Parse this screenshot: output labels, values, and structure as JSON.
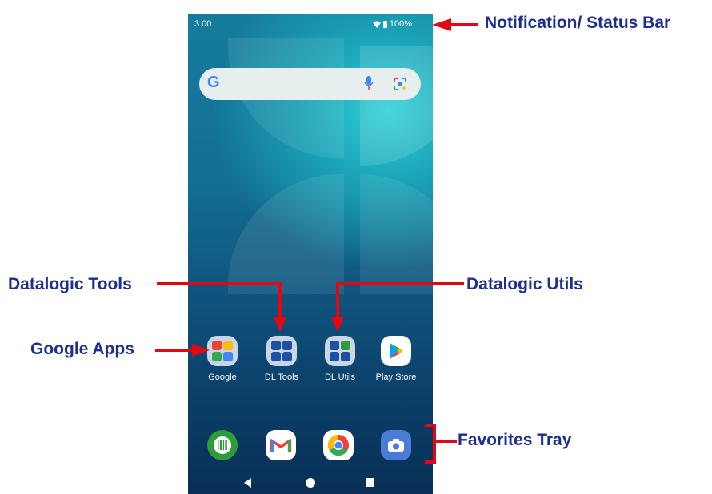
{
  "status_bar": {
    "time": "3:00",
    "battery": "100%"
  },
  "apps": [
    {
      "label": "Google"
    },
    {
      "label": "DL Tools"
    },
    {
      "label": "DL Utils"
    },
    {
      "label": "Play Store"
    }
  ],
  "tray": [
    "barcode-scanner-icon",
    "gmail-icon",
    "chrome-icon",
    "camera-icon"
  ],
  "callouts": {
    "status_bar": "Notification/ Status Bar",
    "dl_tools": "Datalogic Tools",
    "dl_utils": "Datalogic Utils",
    "google_apps": "Google Apps",
    "favorites": "Favorites Tray"
  },
  "colors": {
    "callout_text": "#1d2f8c",
    "arrow": "#e30613"
  }
}
